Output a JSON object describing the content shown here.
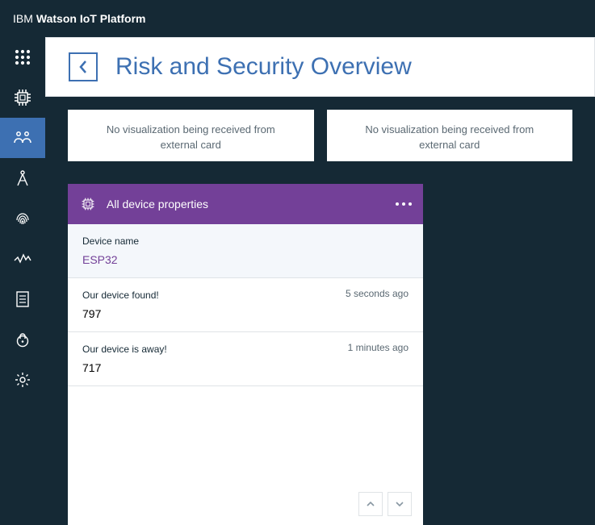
{
  "brand": {
    "light": "IBM",
    "bold": "Watson IoT Platform"
  },
  "page": {
    "title": "Risk and Security Overview"
  },
  "viz_cards": {
    "left": "No visualization being received from external card",
    "right": "No visualization being received from external card"
  },
  "device_card": {
    "title": "All device properties",
    "sections": [
      {
        "label": "Device name",
        "value": "ESP32",
        "time": "",
        "link": true
      },
      {
        "label": "Our device found!",
        "value": "797",
        "time": "5 seconds ago",
        "link": false
      },
      {
        "label": "Our device is away!",
        "value": "717",
        "time": "1 minutes ago",
        "link": false
      }
    ]
  }
}
